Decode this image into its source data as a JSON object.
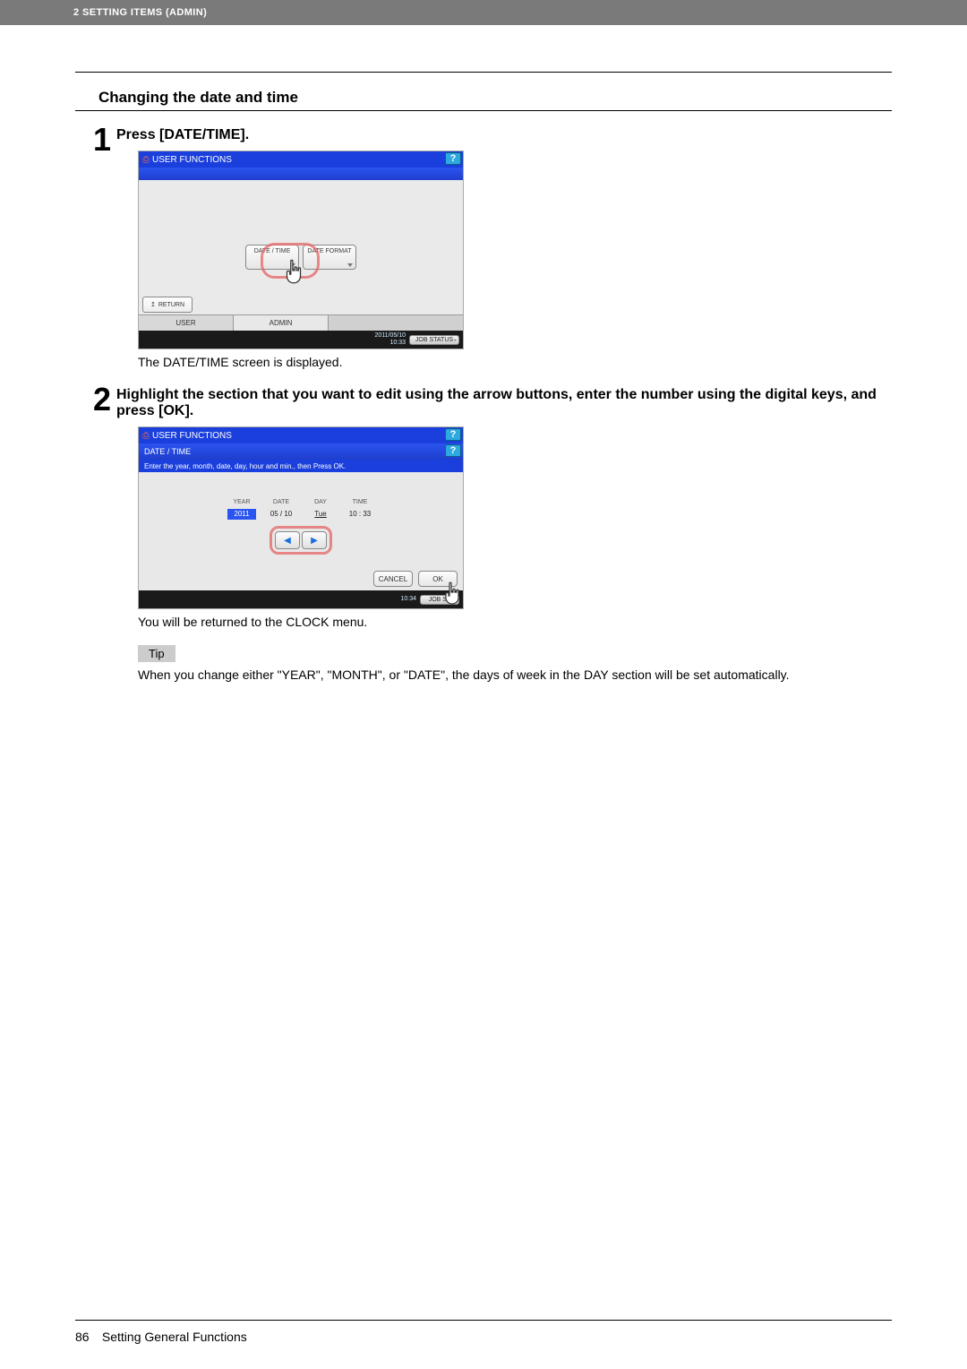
{
  "header_bar": "2 SETTING ITEMS (ADMIN)",
  "section_title": "Changing the date and time",
  "steps": {
    "s1": {
      "num": "1",
      "heading": "Press [DATE/TIME].",
      "caption": "The DATE/TIME screen is displayed."
    },
    "s2": {
      "num": "2",
      "heading": "Highlight the section that you want to edit using the arrow buttons, enter the number using the digital keys, and press [OK].",
      "caption": "You will be returned to the CLOCK menu."
    }
  },
  "screen1": {
    "title": "USER FUNCTIONS",
    "btn_datetime": "DATE / TIME",
    "btn_dateformat": "DATE FORMAT",
    "btn_return": "RETURN",
    "tab_user": "USER",
    "tab_admin": "ADMIN",
    "timestamp": "2011/05/10\n10:33",
    "jobstatus": "JOB STATUS",
    "help": "?"
  },
  "screen2": {
    "title": "USER FUNCTIONS",
    "subtitle": "DATE / TIME",
    "instruction": "Enter the year, month, date, day, hour and min., then Press OK.",
    "labels": {
      "year": "YEAR",
      "date": "DATE",
      "day": "DAY",
      "time": "TIME"
    },
    "values": {
      "year": "2011",
      "date": "05 / 10",
      "day": "Tue",
      "time": "10 : 33"
    },
    "cancel": "CANCEL",
    "ok": "OK",
    "timestamp": "10:34",
    "jobst": "JOB ST",
    "help": "?"
  },
  "tip_label": "Tip",
  "tip_text": "When you change either \"YEAR\", \"MONTH\", or \"DATE\", the days of week in the DAY section will be set automatically.",
  "footer": {
    "pagenum": "86",
    "section": "Setting General Functions"
  }
}
